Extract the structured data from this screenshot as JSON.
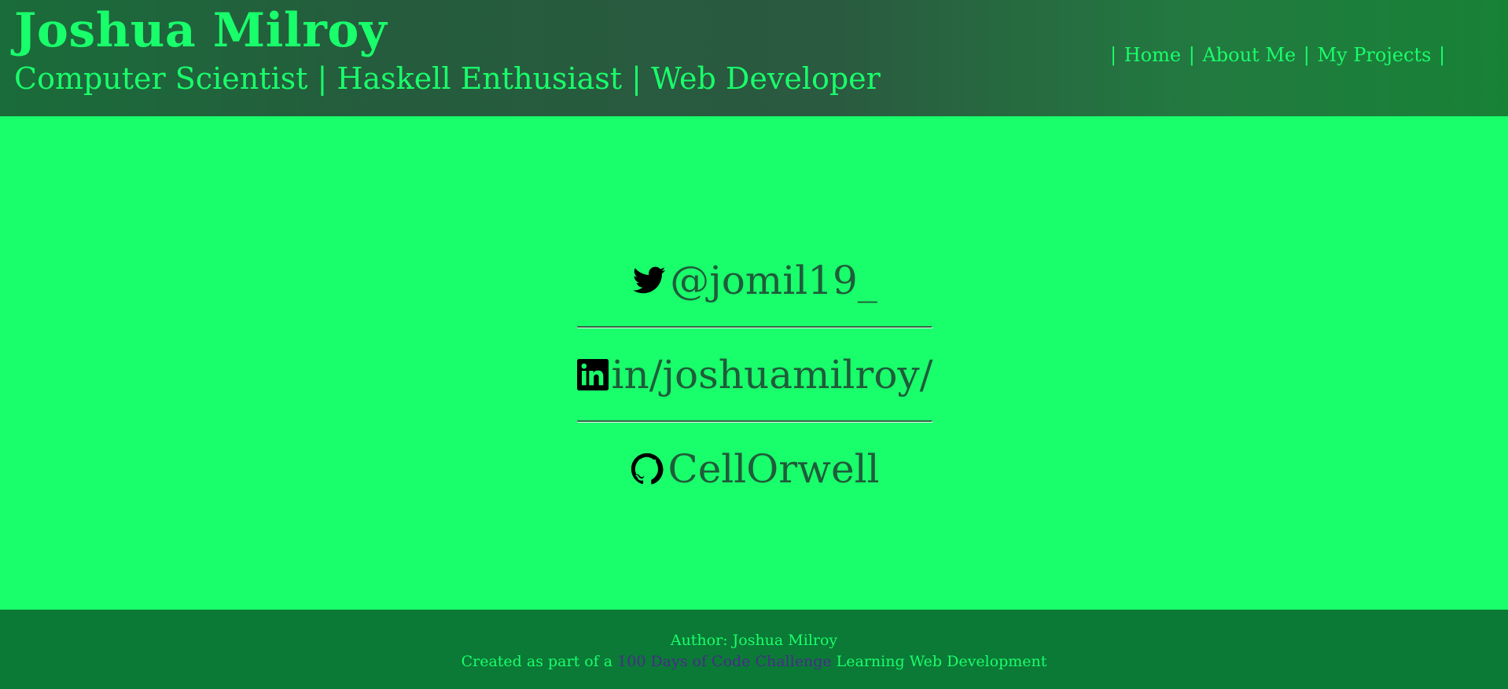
{
  "header": {
    "title": "Joshua Milroy",
    "tagline": "Computer Scientist | Haskell Enthusiast | Web Developer",
    "nav": {
      "separator": "|",
      "items": [
        "Home",
        "About Me",
        "My Projects"
      ]
    }
  },
  "social": {
    "items": [
      {
        "icon": "twitter-icon",
        "label": "@jomil19_"
      },
      {
        "icon": "linkedin-icon",
        "label": "in/joshuamilroy/"
      },
      {
        "icon": "github-icon",
        "label": "CellOrwell"
      }
    ]
  },
  "footer": {
    "author_line": "Author: Joshua Milroy",
    "created_prefix": "Created as part of a",
    "challenge_link": "100 Days of Code Challenge",
    "created_suffix": "Learning Web Development"
  },
  "colors": {
    "background": "#19ff6b",
    "header_gradient": "#255c3d",
    "footer": "#0a7a36",
    "text_dark": "#1f5c3a",
    "accent": "#19ff6b",
    "link": "#4a2a8a"
  }
}
